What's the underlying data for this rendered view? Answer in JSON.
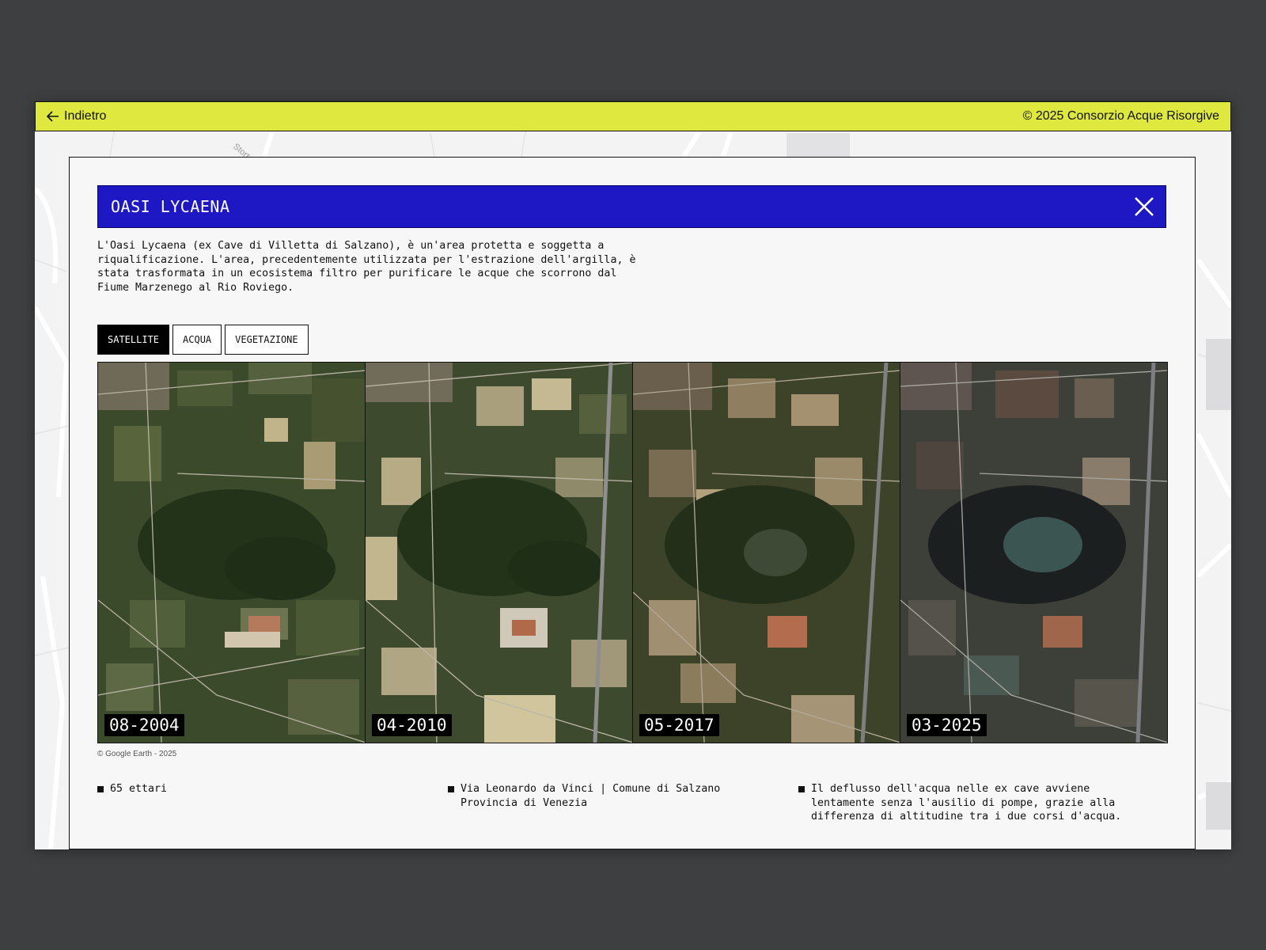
{
  "topbar": {
    "back_label": "Indietro",
    "copyright": "© 2025 Consorzio Acque Risorgive"
  },
  "map": {
    "street_label": "Storto"
  },
  "panel": {
    "title": "OASI LYCAENA",
    "description": "L'Oasi Lycaena (ex Cave di Villetta di Salzano), è un'area protetta e soggetta a\nriqualificazione. L'area, precedentemente utilizzata per l'estrazione dell'argilla, è\nstata trasformata in un ecosistema filtro per purificare le acque che scorrono dal\nFiume Marzenego al Rio Roviego.",
    "tabs": [
      {
        "label": "SATELLITE",
        "active": true
      },
      {
        "label": "ACQUA",
        "active": false
      },
      {
        "label": "VEGETAZIONE",
        "active": false
      }
    ],
    "images": [
      {
        "date": "08-2004"
      },
      {
        "date": "04-2010"
      },
      {
        "date": "05-2017"
      },
      {
        "date": "03-2025"
      }
    ],
    "image_credit": "© Google Earth - 2025",
    "info": [
      {
        "text": "65 ettari"
      },
      {
        "text": "Via Leonardo da Vinci | Comune di Salzano\nProvincia di Venezia"
      },
      {
        "text": "Il deflusso dell'acqua nelle ex cave avviene\nlentamente senza l'ausilio di pompe, grazie alla\ndifferenza di altitudine tra i due corsi d'acqua."
      }
    ]
  },
  "colors": {
    "topbar": "#dfe83f",
    "title_bar": "#1e17c4",
    "page_bg": "#3d3f41"
  },
  "icons": {
    "back": "arrow-left-icon",
    "close": "close-icon"
  }
}
